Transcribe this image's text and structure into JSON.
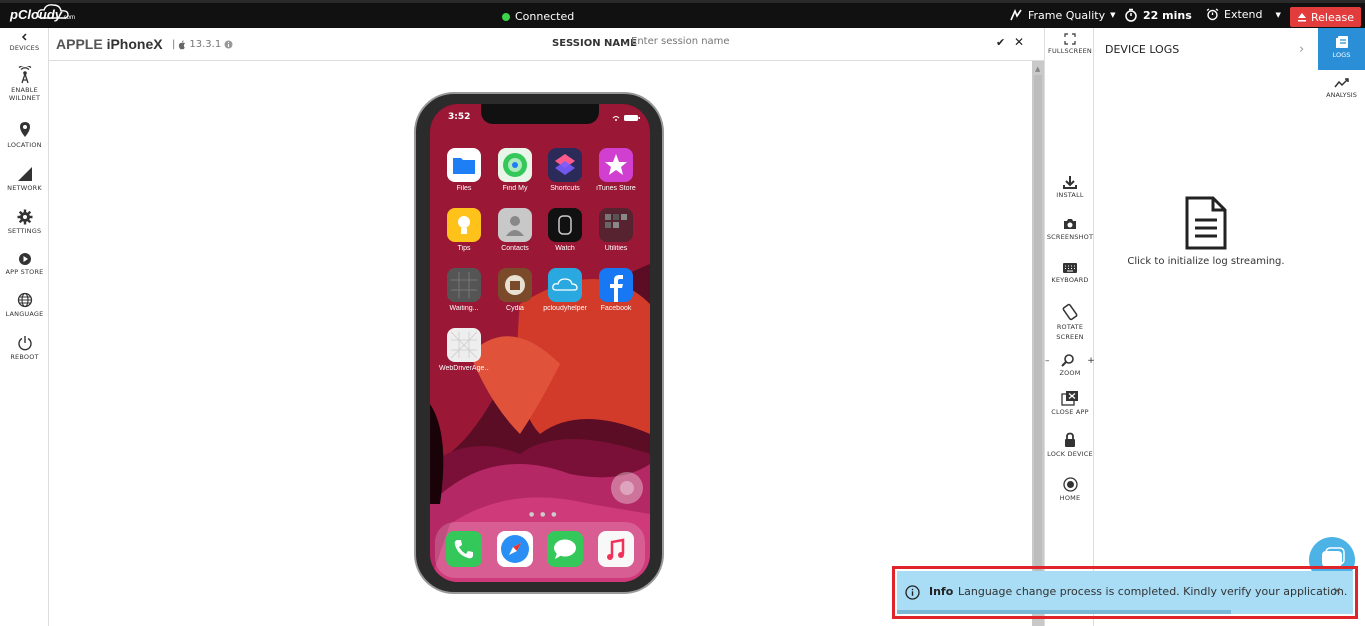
{
  "topbar": {
    "logo": "pCloudy",
    "logo_suffix": ".com",
    "status": "Connected",
    "frame_quality_label": "Frame Quality",
    "timer": "22 mins",
    "extend_label": "Extend",
    "release_label": "Release"
  },
  "leftbar": {
    "items": [
      {
        "label": "DEVICES",
        "icon": "chevron-left-icon"
      },
      {
        "label": "ENABLE",
        "label2": "WILDNET",
        "icon": "antenna-icon"
      },
      {
        "label": "LOCATION",
        "icon": "location-pin-icon"
      },
      {
        "label": "NETWORK",
        "icon": "signal-icon"
      },
      {
        "label": "SETTINGS",
        "icon": "gear-icon"
      },
      {
        "label": "APP STORE",
        "icon": "play-icon"
      },
      {
        "label": "LANGUAGE",
        "icon": "globe-icon"
      },
      {
        "label": "REBOOT",
        "icon": "power-icon"
      }
    ]
  },
  "session": {
    "brand": "APPLE",
    "model": "iPhoneX",
    "separator": "|",
    "os_version": "13.3.1",
    "session_label": "SESSION NAME",
    "session_placeholder": "Enter session name"
  },
  "rightbar": {
    "fullscreen": "FULLSCREEN",
    "install": "INSTALL",
    "screenshot": "SCREENSHOT",
    "keyboard": "KEYBOARD",
    "rotate": "ROTATE",
    "rotate2": "SCREEN",
    "zoom": "ZOOM",
    "close_app": "CLOSE APP",
    "lock_device": "LOCK DEVICE",
    "home": "HOME"
  },
  "logs": {
    "title": "DEVICE LOGS",
    "message": "Click to initialize log streaming."
  },
  "farright": {
    "logs_tab": "LOGS",
    "analysis_tab": "ANALYSIS"
  },
  "phone": {
    "time": "3:52",
    "apps": [
      {
        "name": "Files",
        "color": "#1e7ef5"
      },
      {
        "name": "Find My",
        "color": "#34c759"
      },
      {
        "name": "Shortcuts",
        "color": "#6b3ce6"
      },
      {
        "name": "iTunes Store",
        "color": "#e33fd0"
      },
      {
        "name": "Tips",
        "color": "#ffc21a"
      },
      {
        "name": "Contacts",
        "color": "#b8b8b8"
      },
      {
        "name": "Watch",
        "color": "#111111"
      },
      {
        "name": "Utilities",
        "color": "#3a2a30"
      },
      {
        "name": "Waiting...",
        "color": "#555555"
      },
      {
        "name": "Cydia",
        "color": "#7a4a2a"
      },
      {
        "name": "pcloudyhelper",
        "color": "#29a9e0"
      },
      {
        "name": "Facebook",
        "color": "#1877f2"
      },
      {
        "name": "WebDriverAge...",
        "color": "#e8e8e8"
      }
    ],
    "dock": [
      {
        "name": "phone-app",
        "color": "#34c759"
      },
      {
        "name": "safari-app",
        "color": "#2a8ff5"
      },
      {
        "name": "messages-app",
        "color": "#34c759"
      },
      {
        "name": "music-app",
        "color": "#f5f5f5"
      }
    ]
  },
  "toast": {
    "title": "Info",
    "message": "Language change process is completed. Kindly verify your application.",
    "close": "×"
  }
}
